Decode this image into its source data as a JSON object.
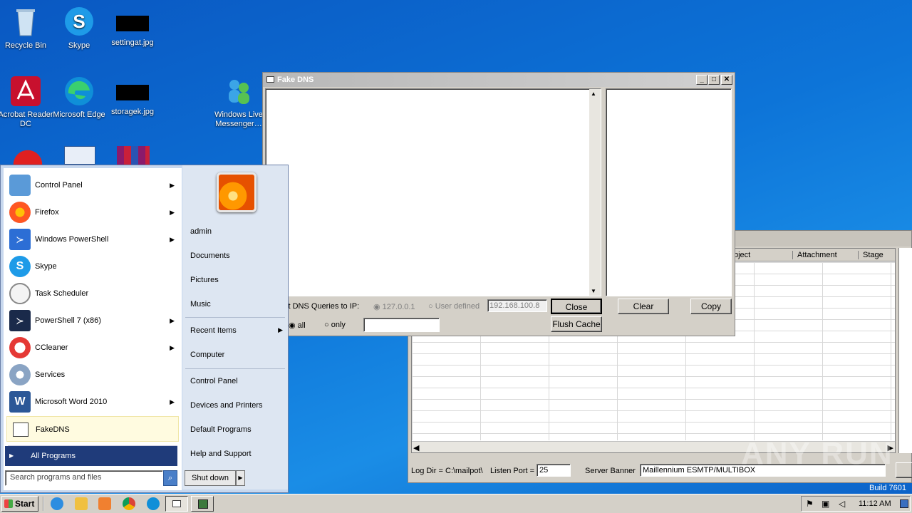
{
  "desktop": {
    "icons": [
      {
        "label": "Recycle Bin"
      },
      {
        "label": "Skype"
      },
      {
        "label": "settingat.jpg"
      },
      {
        "label": "Acrobat Reader DC"
      },
      {
        "label": "Microsoft Edge"
      },
      {
        "label": "storagek.jpg"
      },
      {
        "label": "Windows Live Messenger…"
      }
    ]
  },
  "fakedns": {
    "title": "Fake DNS",
    "redirect_label": "ct DNS Queries to IP:",
    "radio_localhost": "127.0.0.1",
    "radio_user_defined": "User defined",
    "ip_value": "192.168.100.8",
    "close_label": "Close",
    "flush_label": "Flush Cache",
    "clear_label": "Clear",
    "copy_label": "Copy",
    "radio_all": "all",
    "radio_only": "only"
  },
  "mailpot": {
    "columns": [
      "bject",
      "Attachment",
      "Stage"
    ],
    "log_dir": "Log Dir = C:\\mailpot\\",
    "listen_label": "Listen Port =",
    "listen_port": "25",
    "banner_label": "Server Banner",
    "banner_value": "Maillennium ESMTP/MULTIBOX",
    "build": "Build 7601"
  },
  "start_menu": {
    "programs": [
      {
        "label": "Control Panel",
        "submenu": true
      },
      {
        "label": "Firefox",
        "submenu": true
      },
      {
        "label": "Windows PowerShell",
        "submenu": true
      },
      {
        "label": "Skype",
        "submenu": false
      },
      {
        "label": "Task Scheduler",
        "submenu": false
      },
      {
        "label": "PowerShell 7 (x86)",
        "submenu": true
      },
      {
        "label": "CCleaner",
        "submenu": true
      },
      {
        "label": "Services",
        "submenu": false
      },
      {
        "label": "Microsoft Word 2010",
        "submenu": true
      },
      {
        "label": "FakeDNS",
        "submenu": false
      }
    ],
    "all_programs": "All Programs",
    "search_placeholder": "Search programs and files",
    "right_items": [
      "admin",
      "Documents",
      "Pictures",
      "Music",
      "Recent Items",
      "Computer",
      "Control Panel",
      "Devices and Printers",
      "Default Programs",
      "Help and Support"
    ],
    "shutdown_label": "Shut down"
  },
  "taskbar": {
    "start_label": "Start",
    "clock": "11:12 AM"
  },
  "watermark": "ANY RUN"
}
